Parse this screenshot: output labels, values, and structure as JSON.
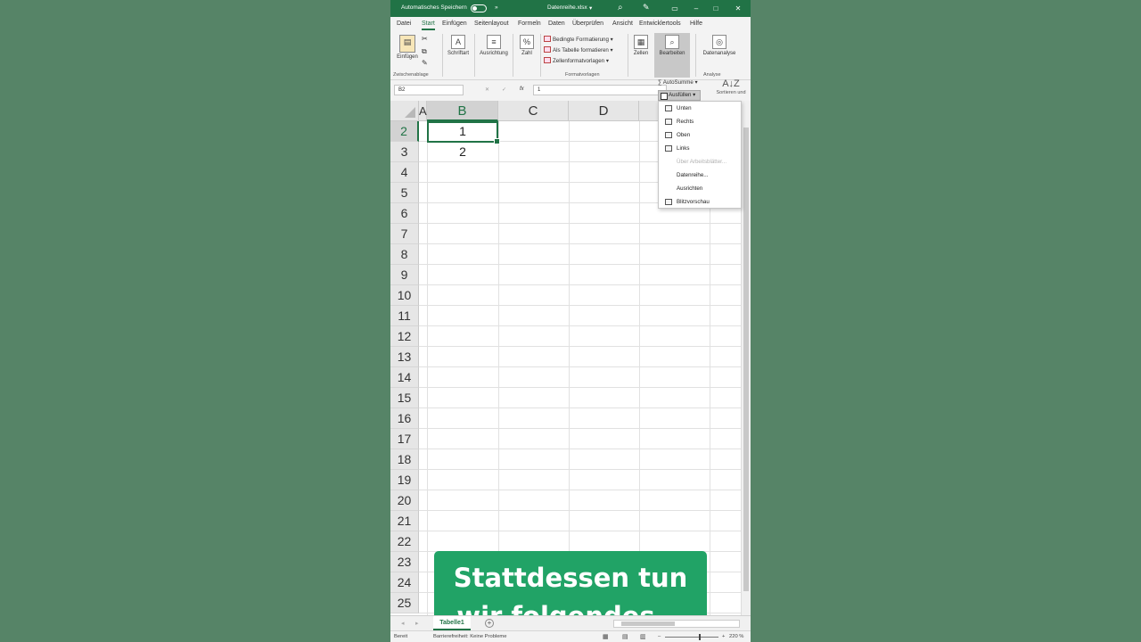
{
  "titlebar": {
    "autosave_label": "Automatisches Speichern",
    "more_symbol": "»",
    "filename": "Datenreihe.xlsx",
    "filename_caret": "▾",
    "search_glyph": "⌕",
    "pen_glyph": "✎",
    "ribbon_display_glyph": "▭",
    "minimize_glyph": "–",
    "maximize_glyph": "□",
    "close_glyph": "✕"
  },
  "tabs": [
    "Datei",
    "Start",
    "Einfügen",
    "Seitenlayout",
    "Formeln",
    "Daten",
    "Überprüfen",
    "Ansicht",
    "Entwicklertools",
    "Hilfe"
  ],
  "ribbon": {
    "paste_label": "Einfügen",
    "clipboard_group": "Zwischenablage",
    "font_label": "Schriftart",
    "alignment_label": "Ausrichtung",
    "number_label": "Zahl",
    "conditional_formatting": "Bedingte Formatierung ▾",
    "format_as_table": "Als Tabelle formatieren ▾",
    "cell_styles": "Zellenformatvorlagen ▾",
    "styles_group": "Formatvorlagen",
    "cells_label": "Zellen",
    "editing_label": "Bearbeiten",
    "data_analysis_label": "Datenanalyse",
    "analysis_group": "Analyse"
  },
  "formulabar": {
    "namebox": "B2",
    "cancel_glyph": "✕",
    "confirm_glyph": "✓",
    "fx_label": "fx",
    "value": "1"
  },
  "grid": {
    "columns": [
      "A",
      "B",
      "C",
      "D"
    ],
    "rows": [
      "2",
      "3",
      "4",
      "5",
      "6",
      "7",
      "8",
      "9",
      "10",
      "11",
      "12",
      "13",
      "14",
      "15",
      "16",
      "17",
      "18",
      "19",
      "20",
      "21",
      "22",
      "23",
      "24",
      "25"
    ],
    "cells": [
      {
        "ref": "B2",
        "value": "1"
      },
      {
        "ref": "B3",
        "value": "2"
      }
    ]
  },
  "editing_panel": {
    "autosum": "∑ AutoSumme ▾",
    "fill": "Ausfüllen ▾",
    "sort_glyph": "A↓Z",
    "sort_filter": "Sortieren und"
  },
  "fill_menu": {
    "items": [
      {
        "label": "Unten",
        "enabled": true
      },
      {
        "label": "Rechts",
        "enabled": true
      },
      {
        "label": "Oben",
        "enabled": true
      },
      {
        "label": "Links",
        "enabled": true
      },
      {
        "label": "Über Arbeitsblätter...",
        "enabled": false
      },
      {
        "label": "Datenreihe...",
        "enabled": true
      },
      {
        "label": "Ausrichten",
        "enabled": true
      },
      {
        "label": "Blitzvorschau",
        "enabled": true
      }
    ]
  },
  "caption": {
    "line1": "Stattdessen tun",
    "line2": "wir folgendes..."
  },
  "sheetbar": {
    "sheet_name": "Tabelle1",
    "add_sheet_glyph": "+"
  },
  "statusbar": {
    "ready": "Bereit",
    "accessibility": "Barrierefreiheit: Keine Probleme",
    "zoom_out": "–",
    "zoom_in": "+",
    "zoom": "220 %"
  },
  "colors": {
    "excel_green": "#217346",
    "caption_green": "#21a366",
    "background": "#568467"
  }
}
